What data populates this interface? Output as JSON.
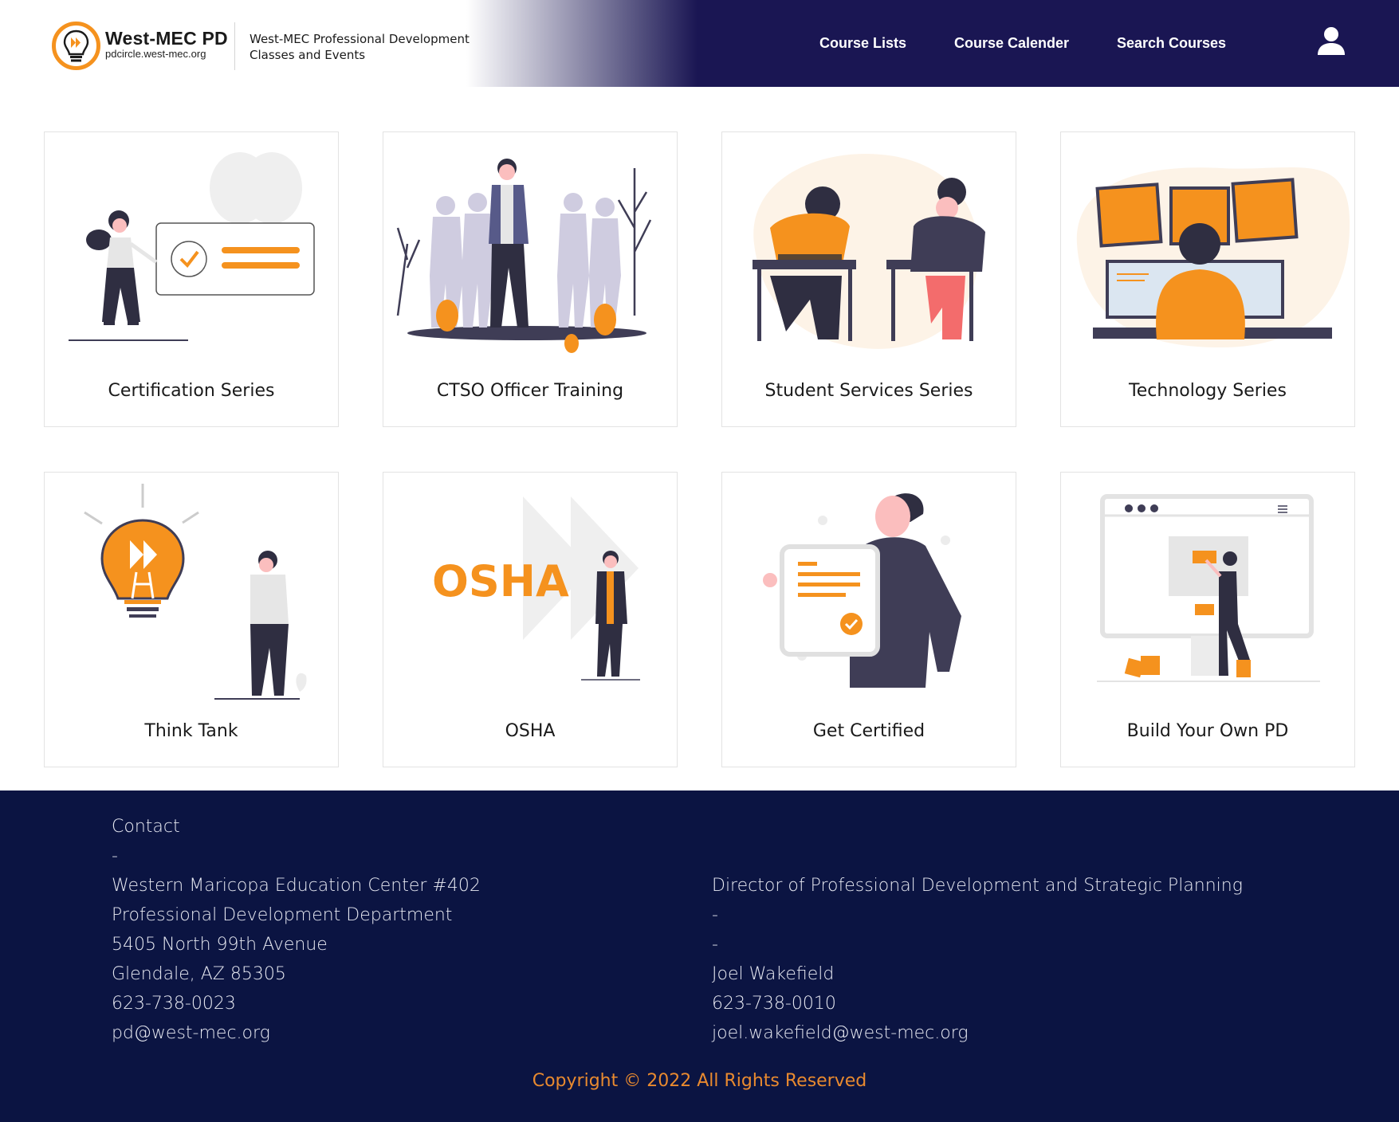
{
  "header": {
    "brand_title": "West-MEC PD",
    "brand_url": "pdcircle.west-mec.org",
    "tagline_line1": "West-MEC Professional Development",
    "tagline_line2": "Classes and Events",
    "nav": [
      "Course Lists",
      "Course Calender",
      "Search Courses"
    ],
    "user_icon": "user-icon"
  },
  "cards": [
    {
      "label": "Certification Series",
      "icon": "certificate-illustration"
    },
    {
      "label": "CTSO Officer Training",
      "icon": "group-leader-illustration"
    },
    {
      "label": "Student Services Series",
      "icon": "students-desk-illustration"
    },
    {
      "label": "Technology Series",
      "icon": "monitors-illustration"
    },
    {
      "label": "Think Tank",
      "icon": "lightbulb-illustration"
    },
    {
      "label": "OSHA",
      "icon": "osha-illustration",
      "art_text": "OSHA"
    },
    {
      "label": "Get Certified",
      "icon": "certified-person-illustration"
    },
    {
      "label": "Build Your Own PD",
      "icon": "builder-illustration"
    }
  ],
  "footer": {
    "left": [
      "Contact",
      "-",
      "Western Maricopa Education Center #402",
      "Professional Development Department",
      "5405 North 99th Avenue",
      "Glendale, AZ 85305",
      "623-738-0023",
      "pd@west-mec.org"
    ],
    "right": [
      "Director of Professional Development and Strategic Planning",
      "-",
      "-",
      "Joel Wakefield",
      "623-738-0010",
      "joel.wakefield@west-mec.org"
    ],
    "copyright": "Copyright © 2022 All Rights Reserved"
  },
  "colors": {
    "header_navy": "#1a1653",
    "footer_navy": "#0b1442",
    "accent_orange": "#f5921e",
    "copyright_orange": "#e98a2f"
  }
}
